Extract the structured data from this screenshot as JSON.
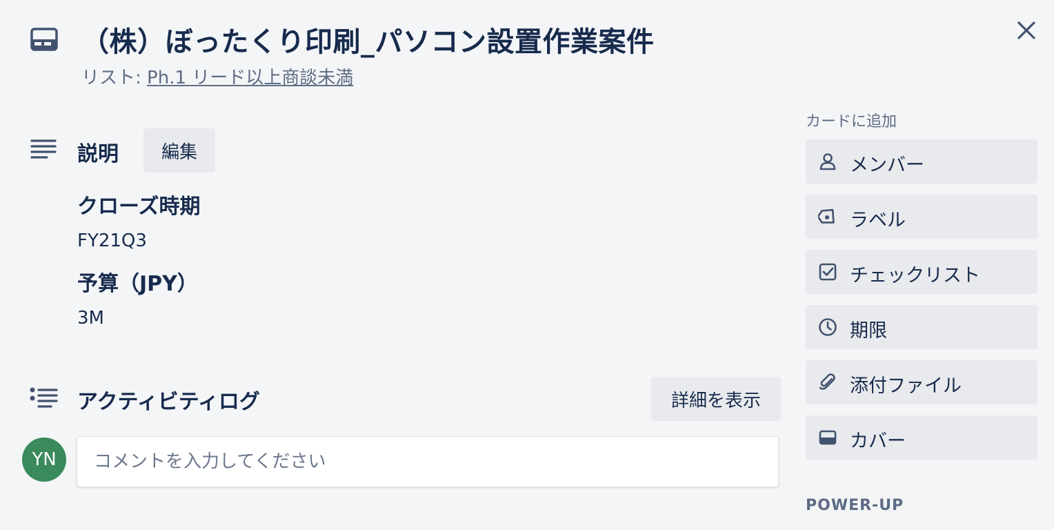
{
  "card": {
    "title": "（株）ぼったくり印刷_パソコン設置作業案件",
    "list_prefix": "リスト: ",
    "list_name": "Ph.1 リード以上商談未満"
  },
  "description": {
    "heading": "説明",
    "edit_label": "編集",
    "close_date_label": "クローズ時期",
    "close_date_value": "FY21Q3",
    "budget_label": "予算（JPY）",
    "budget_value": "3M"
  },
  "activity": {
    "heading": "アクティビティログ",
    "show_details_label": "詳細を表示",
    "avatar_initials": "YN",
    "comment_placeholder": "コメントを入力してください"
  },
  "sidebar": {
    "heading": "カードに追加",
    "buttons": [
      {
        "label": "メンバー",
        "icon": "person-icon"
      },
      {
        "label": "ラベル",
        "icon": "tag-icon"
      },
      {
        "label": "チェックリスト",
        "icon": "checkbox-icon"
      },
      {
        "label": "期限",
        "icon": "clock-icon"
      },
      {
        "label": "添付ファイル",
        "icon": "paperclip-icon"
      },
      {
        "label": "カバー",
        "icon": "card-cover-icon"
      }
    ],
    "powerup_heading": "POWER-UP"
  },
  "colors": {
    "background": "#f4f5f7",
    "text": "#172b4d",
    "muted": "#5e6c84",
    "button_bg": "#e9eaed",
    "avatar_bg": "#3a8a5b"
  }
}
